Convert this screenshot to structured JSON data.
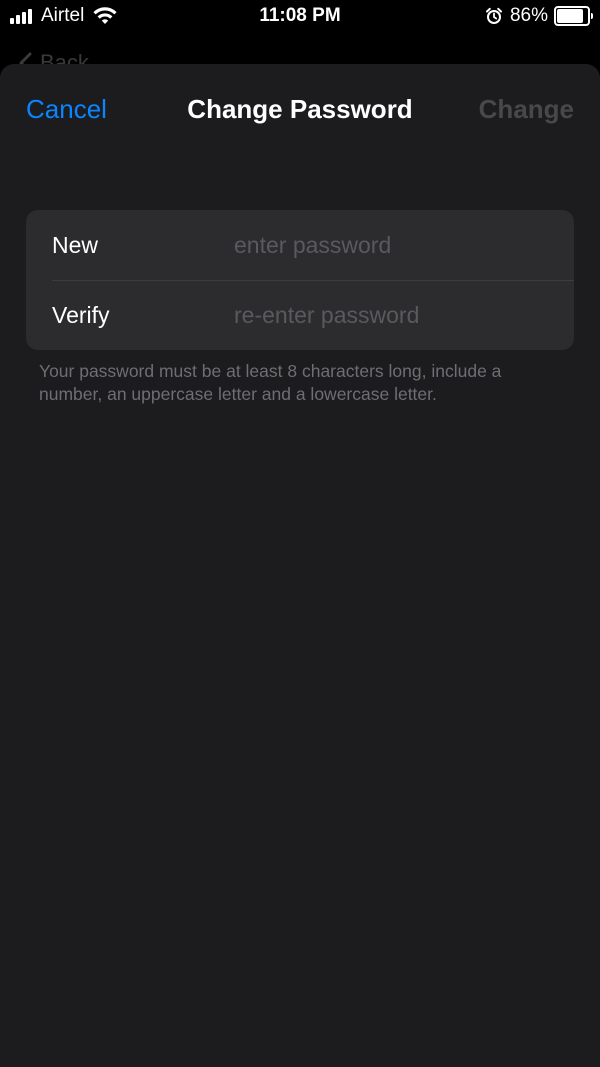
{
  "status_bar": {
    "carrier": "Airtel",
    "time": "11:08 PM",
    "battery_percent": "86%",
    "battery_level": 0.86,
    "icons": [
      "signal-icon",
      "wifi-icon",
      "alarm-icon",
      "battery-icon"
    ]
  },
  "background": {
    "back_label": "Back"
  },
  "nav": {
    "cancel_label": "Cancel",
    "title": "Change Password",
    "change_label": "Change"
  },
  "form": {
    "new_label": "New",
    "new_placeholder": "enter password",
    "new_value": "",
    "verify_label": "Verify",
    "verify_placeholder": "re-enter password",
    "verify_value": ""
  },
  "footer_note": "Your password must be at least 8 characters long, include a number, an uppercase letter and a lowercase letter.",
  "colors": {
    "accent": "#0a84ff",
    "sheet_bg": "#1c1c1e",
    "group_bg": "#2c2c2e",
    "disabled_text": "#48484a"
  }
}
